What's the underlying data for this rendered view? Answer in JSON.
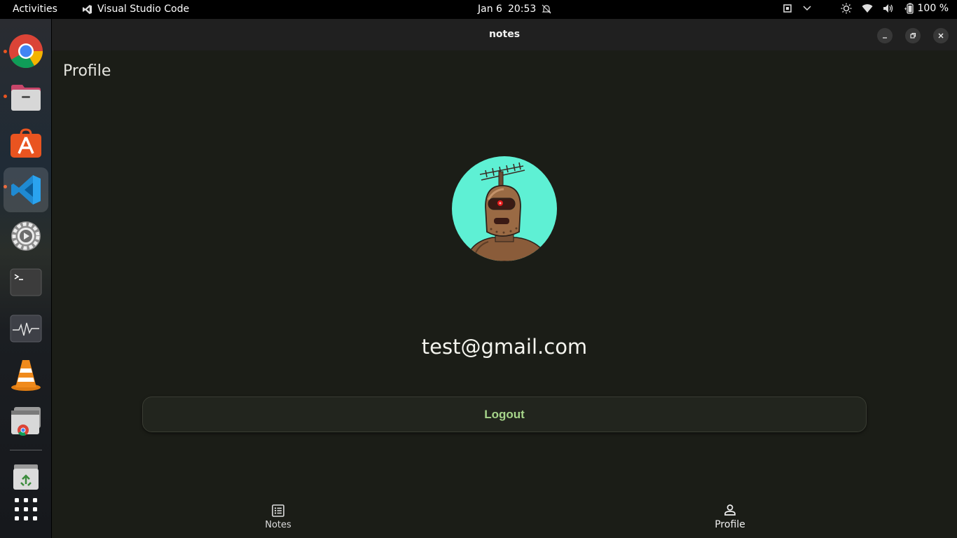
{
  "topbar": {
    "activities": "Activities",
    "app_name": "Visual Studio Code",
    "date": "Jan 6",
    "time": "20:53",
    "battery": "100 %"
  },
  "dock": {
    "items": [
      "chrome-icon",
      "files-icon",
      "app-center-icon",
      "vscode-icon",
      "settings-icon",
      "terminal-icon",
      "system-monitor-icon",
      "vlc-icon",
      "chrome-apps-icon",
      "trash-icon",
      "show-apps-icon"
    ]
  },
  "window": {
    "title": "notes"
  },
  "page": {
    "title": "Profile",
    "email": "test@gmail.com",
    "logout_label": "Logout"
  },
  "bottom_nav": {
    "items": [
      {
        "label": "Notes",
        "icon": "notes-list-icon"
      },
      {
        "label": "Profile",
        "icon": "person-icon"
      }
    ],
    "selected": "Profile"
  },
  "colors": {
    "window_bg": "#1b1d17",
    "accent": "#a6d58a",
    "avatar_bg": "#5ef0d4",
    "dock_indicator": "#e95420"
  }
}
